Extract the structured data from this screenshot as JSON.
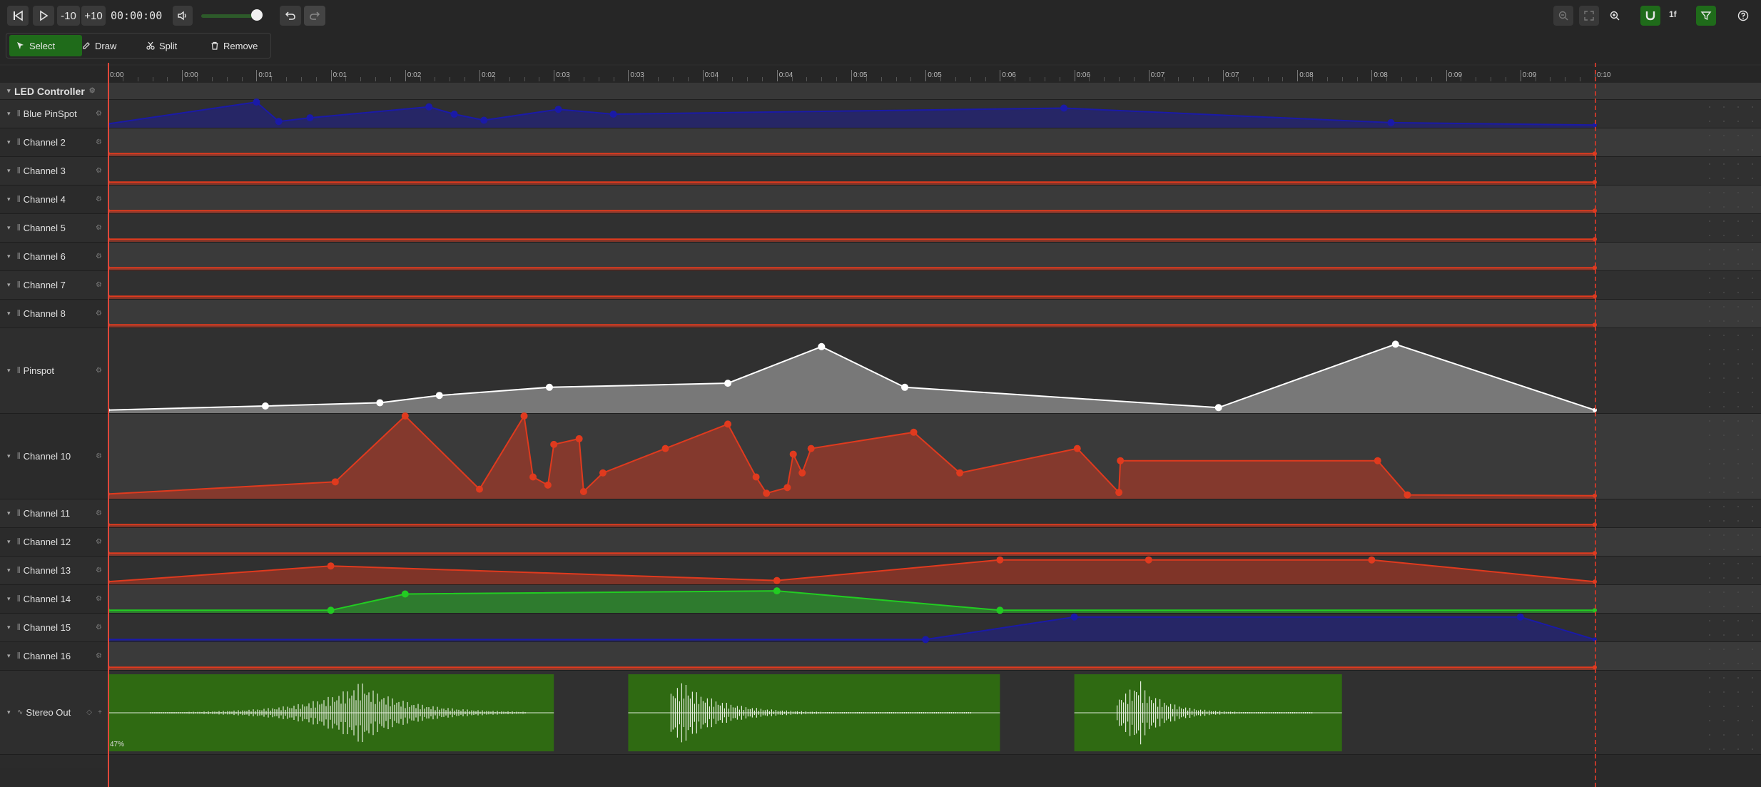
{
  "toolbar": {
    "skip_back_label": "-10",
    "skip_forward_label": "+10",
    "timecode": "00:00:00",
    "volume": 0.85,
    "tools": [
      {
        "label": "Select",
        "active": true,
        "icon": "cursor-icon"
      },
      {
        "label": "Draw",
        "active": false,
        "icon": "pencil-icon"
      },
      {
        "label": "Split",
        "active": false,
        "icon": "scissors-icon"
      },
      {
        "label": "Remove",
        "active": false,
        "icon": "trash-icon"
      }
    ],
    "snap_label": "1f",
    "accent_color": "#1f6b1a"
  },
  "ruler": {
    "labels": [
      "0:00",
      "0:00",
      "0:01",
      "0:01",
      "0:02",
      "0:02",
      "0:03",
      "0:03",
      "0:04",
      "0:04",
      "0:05",
      "0:05",
      "0:06",
      "0:06",
      "0:07",
      "0:07",
      "0:08",
      "0:08",
      "0:09",
      "0:09",
      "0:10"
    ]
  },
  "group": {
    "name": "LED Controller"
  },
  "tracks": [
    {
      "name": "Blue PinSpot",
      "kind": "automation",
      "color": "#1a1aa8"
    },
    {
      "name": "Channel 2",
      "kind": "automation",
      "color": "#e03a1e"
    },
    {
      "name": "Channel 3",
      "kind": "automation",
      "color": "#e03a1e"
    },
    {
      "name": "Channel 4",
      "kind": "automation",
      "color": "#e03a1e"
    },
    {
      "name": "Channel 5",
      "kind": "automation",
      "color": "#e03a1e"
    },
    {
      "name": "Channel 6",
      "kind": "automation",
      "color": "#e03a1e"
    },
    {
      "name": "Channel 7",
      "kind": "automation",
      "color": "#e03a1e"
    },
    {
      "name": "Channel 8",
      "kind": "automation",
      "color": "#e03a1e"
    },
    {
      "name": "Pinspot",
      "kind": "automation",
      "color": "#ffffff"
    },
    {
      "name": "Channel 10",
      "kind": "automation",
      "color": "#e03a1e"
    },
    {
      "name": "Channel 11",
      "kind": "automation",
      "color": "#e03a1e"
    },
    {
      "name": "Channel 12",
      "kind": "automation",
      "color": "#e03a1e"
    },
    {
      "name": "Channel 13",
      "kind": "automation",
      "color": "#e03a1e"
    },
    {
      "name": "Channel 14",
      "kind": "automation",
      "color": "#22cc22"
    },
    {
      "name": "Channel 15",
      "kind": "automation",
      "color": "#1a1aa8"
    },
    {
      "name": "Channel 16",
      "kind": "automation",
      "color": "#e03a1e"
    },
    {
      "name": "Stereo Out",
      "kind": "audio",
      "color": "#2f6a12"
    }
  ],
  "audio": {
    "percent_label": "47%",
    "clip_color": "#2f6a12"
  }
}
